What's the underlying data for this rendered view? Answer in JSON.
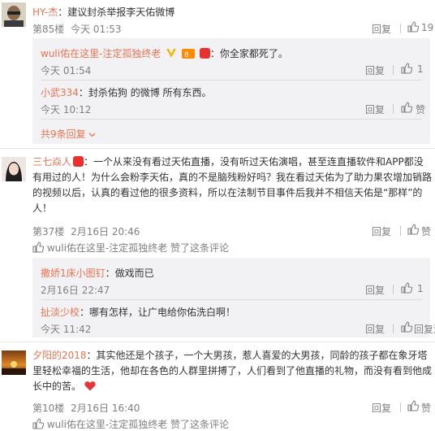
{
  "colors": {
    "name": "#eb7350",
    "muted": "#808080",
    "text": "#333333",
    "subbg": "#f2f2f5",
    "vip_orange": "#f7b500",
    "badge_red": "#e8302f",
    "heart": "#e5363a"
  },
  "actions": {
    "reply": "回复",
    "like": "赞"
  },
  "comments": [
    {
      "author": "HY-杰",
      "text": "：建议封杀举报李天佑微博",
      "floor": "第85楼",
      "time": "今天 01:53",
      "likes": "19",
      "replies": [
        {
          "author": "wuli佑在这里-注定孤独终老",
          "badges": [
            "vip-v-icon",
            "vip-crown-icon",
            "member-badge-icon"
          ],
          "text": "：你全家都死了。",
          "time": "今天 01:54",
          "likes": "1"
        },
        {
          "author": "小武334",
          "text": "：封杀佑狗 的微博 所有东西。",
          "time": "今天 10:12",
          "likes": ""
        }
      ],
      "more": "共9条回复"
    },
    {
      "author": "三七焱人",
      "badges": [
        "member-badge-icon"
      ],
      "text_lines": [
        "：一个从来没有看过天佑直播，没有听过天佑演唱，甚至连直播软件和APP都没",
        "有用过的人！为什么会粉李天佑，真的不是脑残粉好吗？我在看过天佑为了助力果农增加销路",
        "的视频以后，认真的看过他的很多资料，所以在法制节目事件后我并不相信天佑是“那样”的",
        "人！"
      ],
      "floor": "第37楼",
      "time": "2月16日 20:46",
      "likes": "",
      "liked_by": "wuli佑在这里-注定孤独终老 赞了这条评论",
      "replies": [
        {
          "author": "撒娇1床小图钉",
          "text": "：做戏而已",
          "time": "2月16日 22:47",
          "likes": "1"
        },
        {
          "author": "扯淡少校",
          "text": "：哪有怎样，让广电给你佑洗白啊！",
          "time": "今天 11:42",
          "likes": "",
          "last_action": "回复洗"
        }
      ]
    },
    {
      "author": "夕阳的2018",
      "text_lines": [
        "：其实他还是个孩子，一个大男孩，惹人喜爱的大男孩，同龄的孩子都在象牙塔",
        "里轻松幸福的生活，他却在各色的人群里拼搏了，人们看到了他直播的礼物，而没有看到他成",
        "长中的苦。"
      ],
      "floor": "第10楼",
      "time": "2月16日 16:40",
      "likes": "",
      "liked_by": "wuli佑在这里-注定孤独终老 赞了这条评论"
    }
  ]
}
